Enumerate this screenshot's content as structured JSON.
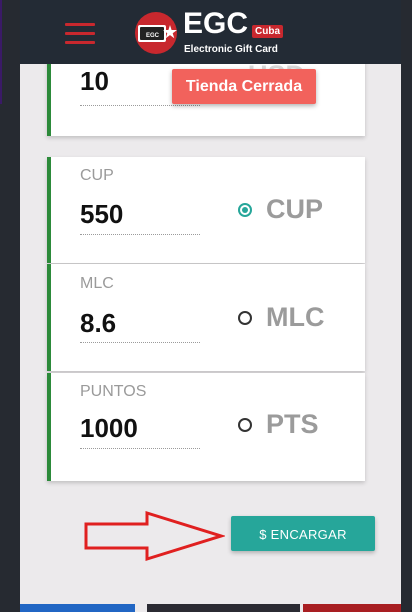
{
  "header": {
    "brand_text": "EGC",
    "brand_badge": "Cuba",
    "brand_subtitle": "Electronic Gift Card"
  },
  "toast": {
    "text": "Tienda Cerrada"
  },
  "usd_row": {
    "value": "10",
    "currency_label": "USD"
  },
  "cup_row": {
    "field_label": "CUP",
    "value": "550",
    "option_label": "CUP",
    "selected": true
  },
  "mlc_row": {
    "field_label": "MLC",
    "value": "8.6",
    "option_label": "MLC",
    "selected": false
  },
  "pts_row": {
    "field_label": "PUNTOS",
    "value": "1000",
    "option_label": "PTS",
    "selected": false
  },
  "actions": {
    "order_button_label": "$ ENCARGAR"
  },
  "colors": {
    "navbar": "#232b35",
    "brand_red": "#c8282e",
    "accent_teal": "#26a69a",
    "card_border_green": "#2c8a3a",
    "toast_red": "#f2625c",
    "annotation_arrow": "#e02020"
  },
  "icons": [
    "hamburger-menu-icon",
    "egc-logo-icon",
    "radio-selected-icon",
    "radio-unselected-icon",
    "annotation-arrow-icon"
  ]
}
